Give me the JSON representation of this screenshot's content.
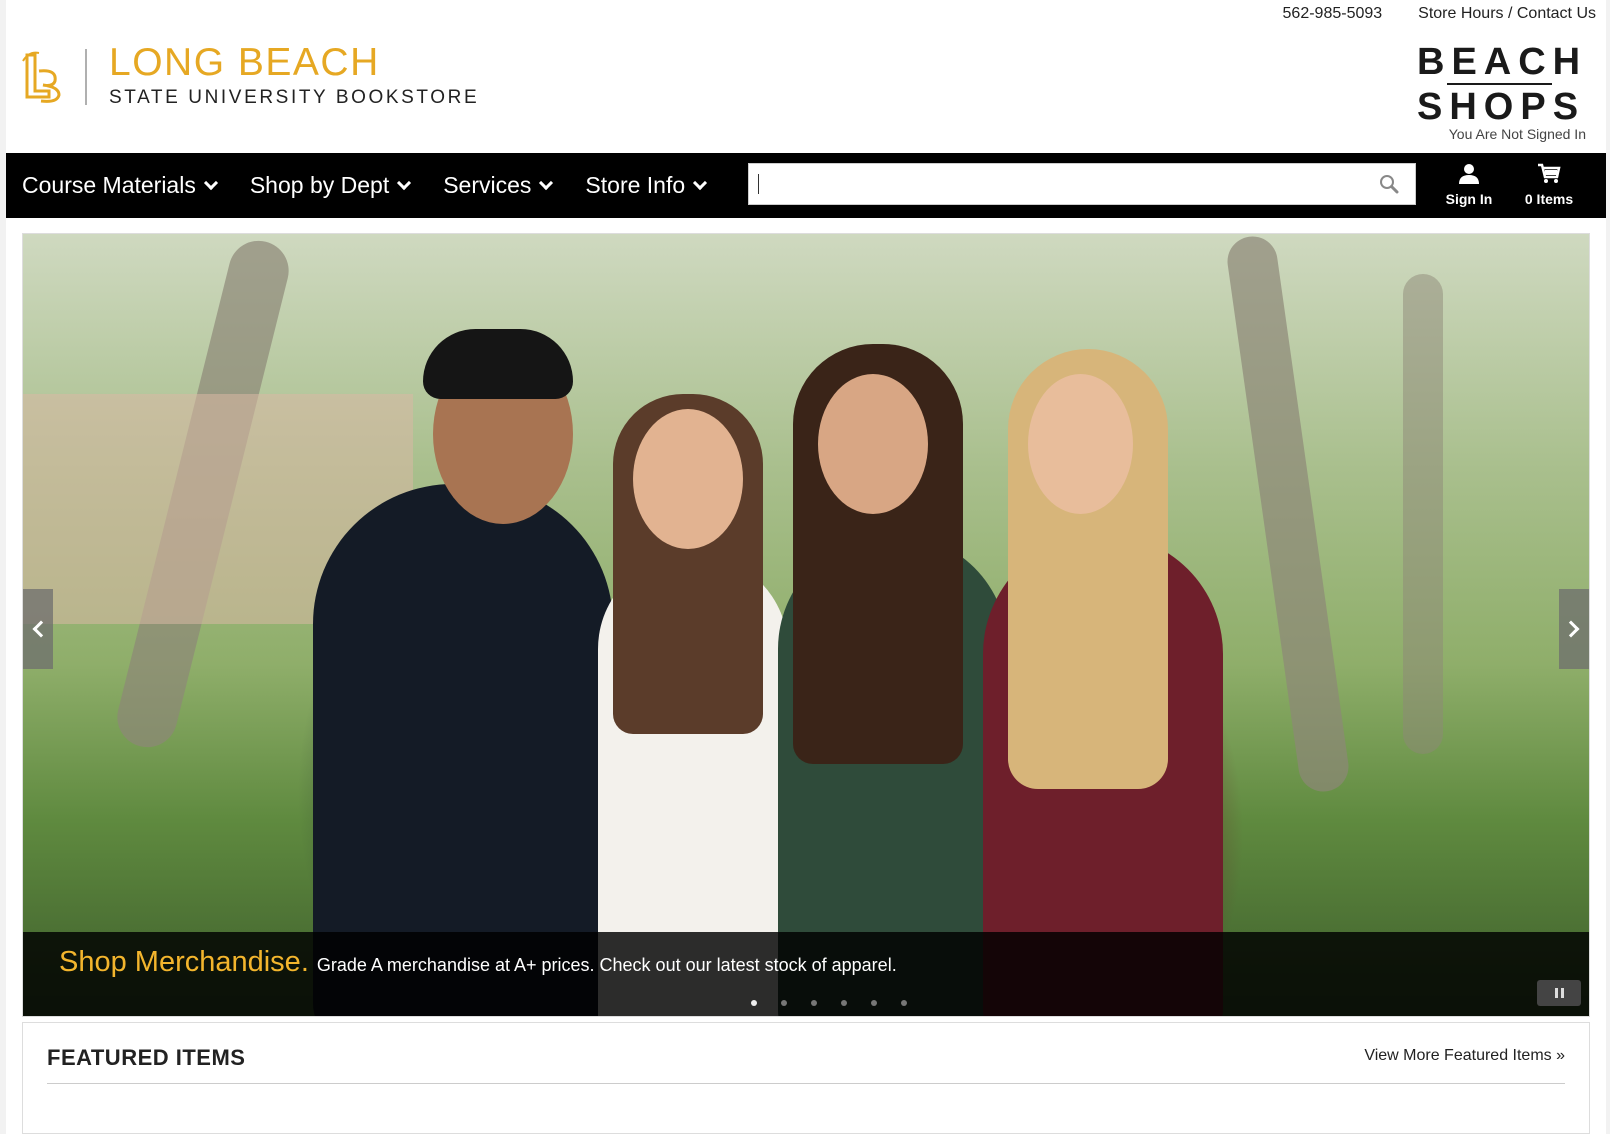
{
  "utility": {
    "phone": "562-985-5093",
    "hours_contact": "Store Hours / Contact Us"
  },
  "logo": {
    "line1": "LONG BEACH",
    "line2": "STATE UNIVERSITY BOOKSTORE",
    "color": "#e6a823"
  },
  "beach_shops": {
    "row1": "BEACH",
    "row2": "SHOPS"
  },
  "account": {
    "status": "You Are Not Signed In"
  },
  "nav": {
    "items": [
      {
        "label": "Course Materials"
      },
      {
        "label": "Shop by Dept"
      },
      {
        "label": "Services"
      },
      {
        "label": "Store Info"
      }
    ],
    "search": {
      "value": "",
      "placeholder": ""
    },
    "sign_in": "Sign In",
    "cart": "0 Items"
  },
  "hero": {
    "headline": "Shop Merchandise.",
    "subtext": "Grade A merchandise at A+ prices. Check out our latest stock of apparel.",
    "slide_count": 6,
    "active_slide": 1,
    "accent": "#f3b52d"
  },
  "featured": {
    "title": "FEATURED ITEMS",
    "link": "View More Featured Items »"
  }
}
